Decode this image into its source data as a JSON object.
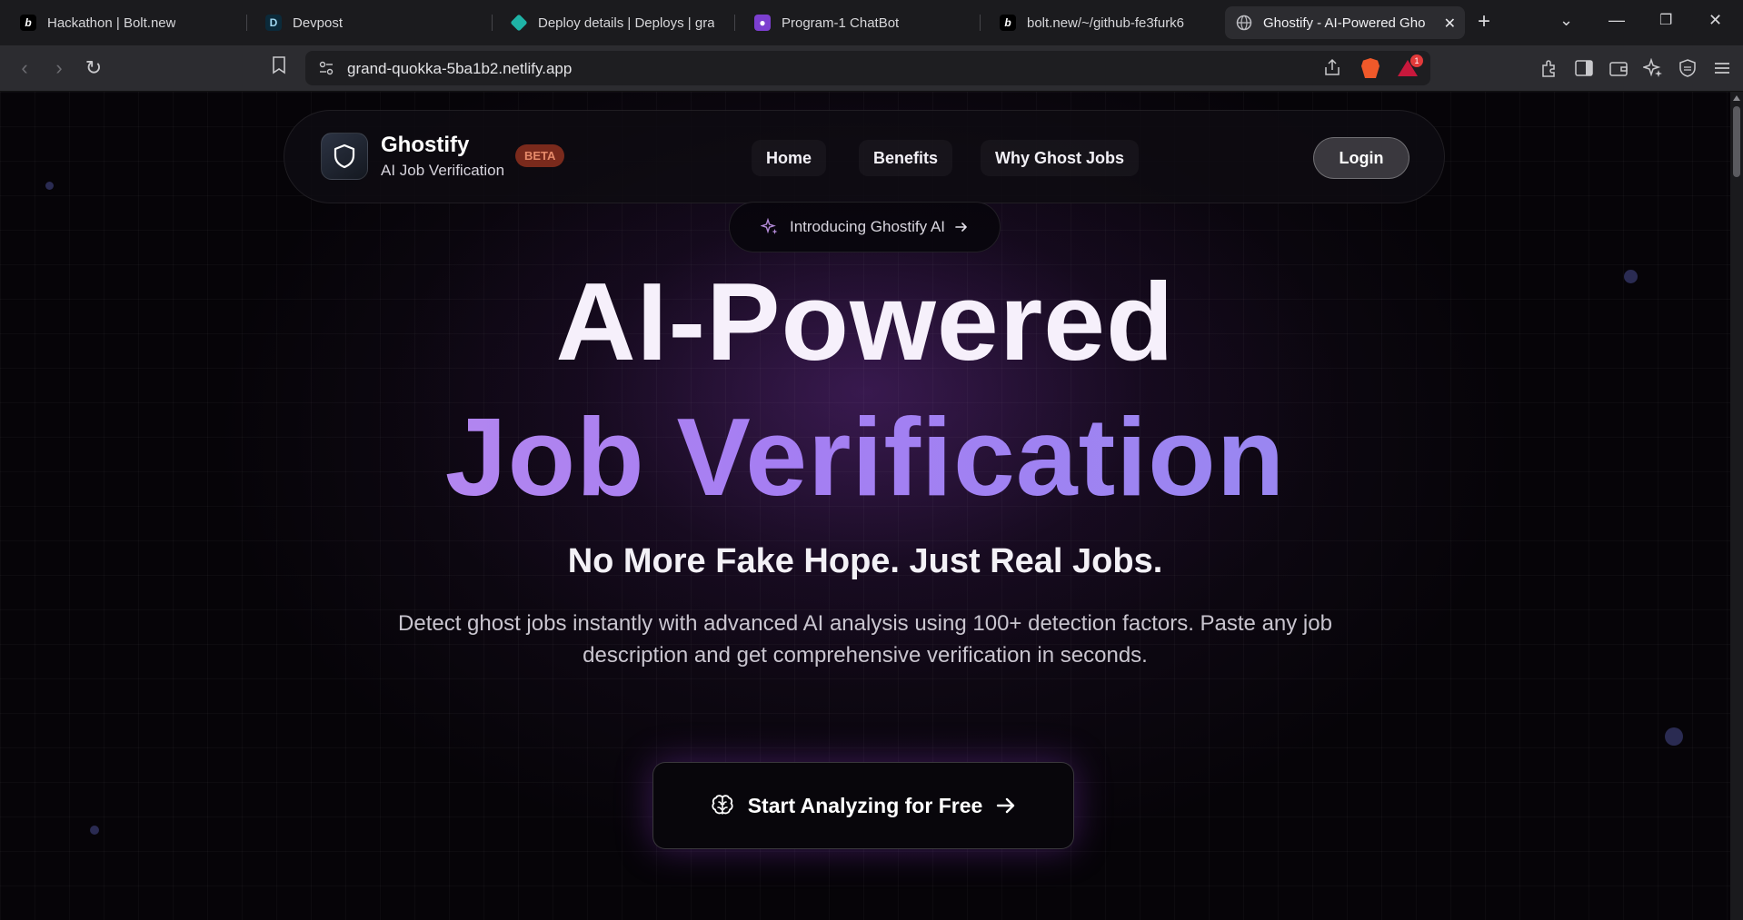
{
  "browser": {
    "tabs": [
      {
        "title": "Hackathon | Bolt.new",
        "favicon": "bolt-icon"
      },
      {
        "title": "Devpost",
        "favicon": "devpost-icon"
      },
      {
        "title": "Deploy details | Deploys | grand",
        "favicon": "netlify-icon"
      },
      {
        "title": "Program-1 ChatBot",
        "favicon": "chatbot-icon"
      },
      {
        "title": "bolt.new/~/github-fe3furk6",
        "favicon": "bolt-icon"
      },
      {
        "title": "Ghostify - AI-Powered Gho",
        "favicon": "globe-icon",
        "active": true
      }
    ],
    "url": "grand-quokka-5ba1b2.netlify.app",
    "rewards_badge": "1"
  },
  "nav": {
    "brand": "Ghostify",
    "tagline": "AI Job Verification",
    "beta": "BETA",
    "links": [
      "Home",
      "Benefits",
      "Why Ghost Jobs"
    ],
    "login": "Login"
  },
  "hero": {
    "intro": "Introducing Ghostify AI",
    "title_line1": "AI-Powered",
    "title_line2": "Job Verification",
    "subtitle": "No More Fake Hope. Just Real Jobs.",
    "description": "Detect ghost jobs instantly with advanced AI analysis using 100+ detection factors. Paste any job description and get comprehensive verification in seconds.",
    "cta": "Start Analyzing for Free"
  },
  "colors": {
    "gradient_start": "#c490ec",
    "gradient_end": "#8f8ef0",
    "beta_bg": "#7a2a1c",
    "beta_text": "#e68a6a"
  }
}
